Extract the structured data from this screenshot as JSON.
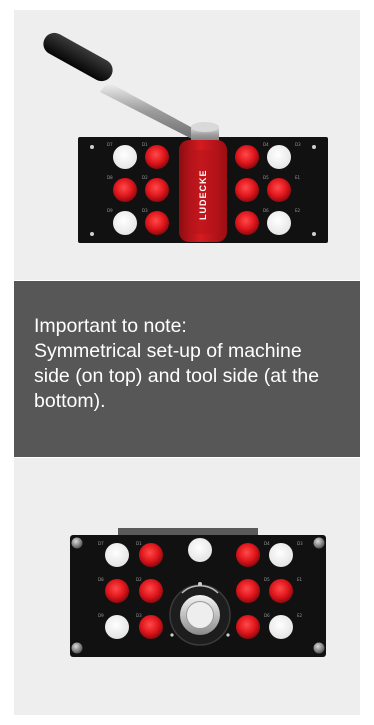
{
  "note": {
    "lines": [
      "Important to note:",
      "Symmetrical set-up of machine",
      "side (on top) and tool side (at the",
      "bottom)."
    ]
  },
  "top_image": {
    "handle_brand": "LUDECKE",
    "port_labels": [
      "D7",
      "D1",
      "D4",
      "D3",
      "D8",
      "D2",
      "D5",
      "E1",
      "D9",
      "D3",
      "D6",
      "E2"
    ]
  },
  "bottom_image": {
    "port_labels": [
      "D7",
      "D1",
      "D4",
      "D3",
      "D8",
      "D2",
      "D5",
      "E1",
      "D9",
      "D3",
      "D6",
      "E2"
    ]
  },
  "colors": {
    "panel_background": "#eeeeee",
    "note_background": "#575757",
    "plate": "#111111",
    "port_red": "#e0161c",
    "port_white": "#ffffff",
    "handle_red": "#c3161c"
  }
}
